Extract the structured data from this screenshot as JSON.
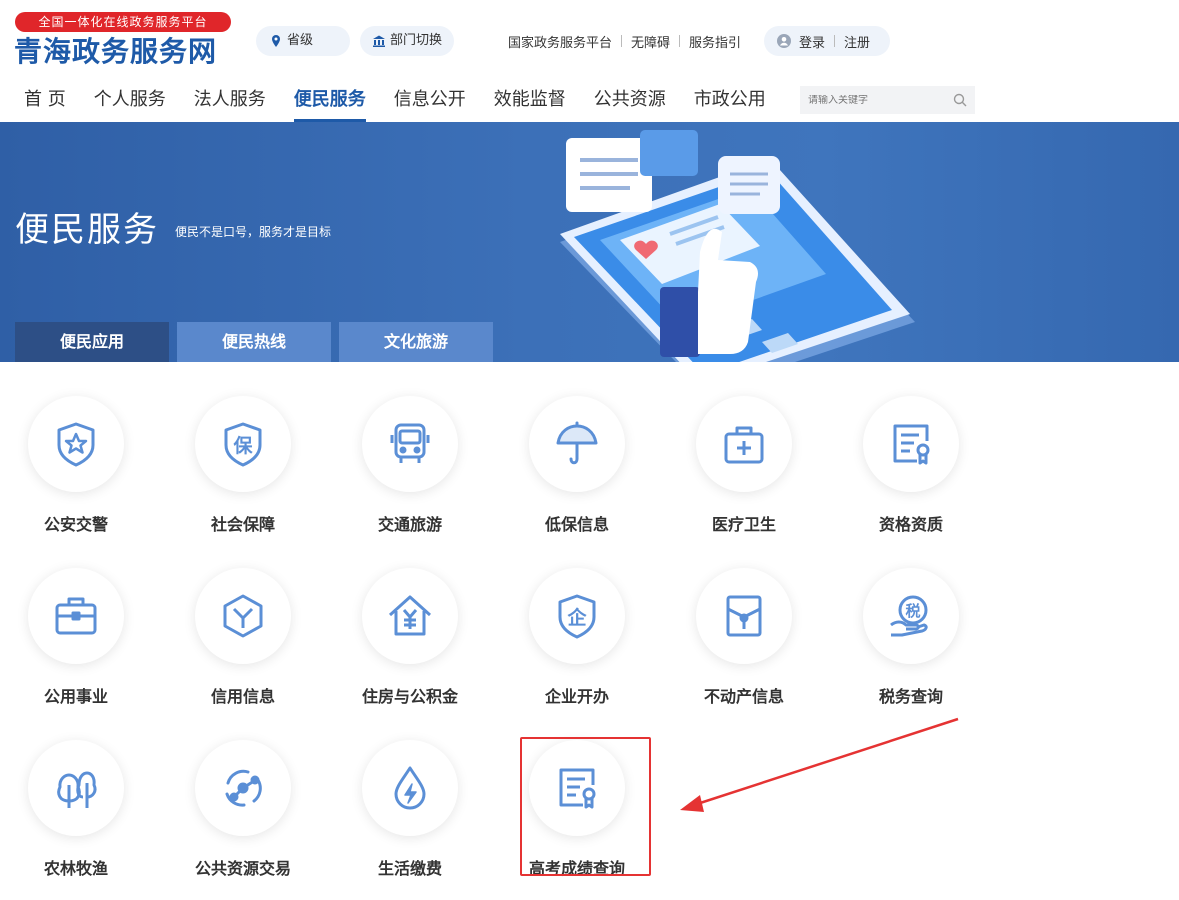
{
  "header": {
    "badge": "全国一体化在线政务服务平台",
    "site_title": "青海政务服务网",
    "province_label": "省级",
    "dept_label": "部门切换",
    "links": [
      "国家政务服务平台",
      "无障碍",
      "服务指引"
    ],
    "login_label": "登录",
    "register_label": "注册"
  },
  "nav": {
    "items": [
      "首 页",
      "个人服务",
      "法人服务",
      "便民服务",
      "信息公开",
      "效能监督",
      "公共资源",
      "市政公用"
    ],
    "active_index": 3,
    "search_placeholder": "请输入关键字"
  },
  "banner": {
    "title": "便民服务",
    "subtitle": "便民不是口号，服务才是目标",
    "tabs": [
      "便民应用",
      "便民热线",
      "文化旅游"
    ],
    "active_tab": 0
  },
  "services": [
    {
      "label": "公安交警",
      "icon": "police-shield-icon"
    },
    {
      "label": "社会保障",
      "icon": "insurance-shield-icon"
    },
    {
      "label": "交通旅游",
      "icon": "bus-icon"
    },
    {
      "label": "低保信息",
      "icon": "umbrella-icon"
    },
    {
      "label": "医疗卫生",
      "icon": "medical-kit-icon"
    },
    {
      "label": "资格资质",
      "icon": "certificate-icon"
    },
    {
      "label": "公用事业",
      "icon": "briefcase-icon"
    },
    {
      "label": "信用信息",
      "icon": "credit-cube-icon"
    },
    {
      "label": "住房与公积金",
      "icon": "house-yuan-icon"
    },
    {
      "label": "企业开办",
      "icon": "enterprise-shield-icon"
    },
    {
      "label": "不动产信息",
      "icon": "property-folder-icon"
    },
    {
      "label": "税务查询",
      "icon": "tax-hand-icon"
    },
    {
      "label": "农林牧渔",
      "icon": "tree-icon"
    },
    {
      "label": "公共资源交易",
      "icon": "resource-network-icon"
    },
    {
      "label": "生活缴费",
      "icon": "water-drop-bolt-icon"
    },
    {
      "label": "高考成绩查询",
      "icon": "certificate-icon"
    }
  ],
  "colors": {
    "brand_blue": "#1e5aa8",
    "icon_blue": "#5b8fd6",
    "badge_red": "#e0262a",
    "highlight_red": "#e53333"
  }
}
